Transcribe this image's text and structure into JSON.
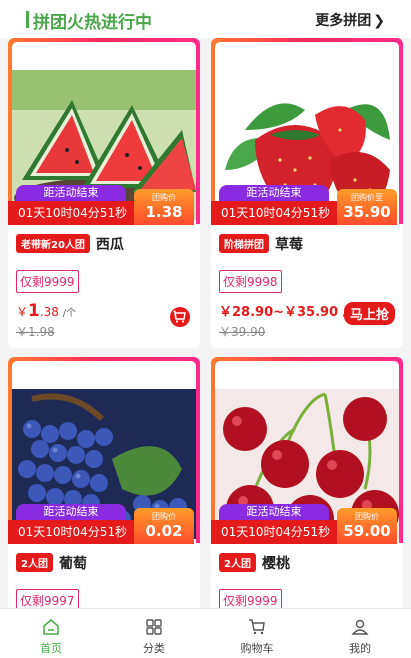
{
  "header": {
    "title": "拼团火热进行中",
    "more": "更多拼团"
  },
  "products": [
    {
      "photo": "watermelon",
      "end_label": "距活动结束",
      "timer": "01天10时04分51秒",
      "price_label": "团购价",
      "price_value": "1.38",
      "badge": "老带新20人团",
      "name": "西瓜",
      "remain": "仅剩9999",
      "price_symbol": "￥",
      "price_int": "1",
      "price_dec": ".38",
      "unit": "/个",
      "orig": "￥1.98",
      "action": "cart-icon"
    },
    {
      "photo": "strawberry",
      "end_label": "距活动结束",
      "timer": "01天10时04分51秒",
      "price_label": "团购价至",
      "price_value": "35.90",
      "badge": "阶梯拼团",
      "name": "草莓",
      "remain": "仅剩9998",
      "price_text": "￥28.90~￥35.90",
      "unit": "/件",
      "orig": "￥39.90",
      "action": "马上抢"
    },
    {
      "photo": "grape",
      "end_label": "距活动结束",
      "timer": "01天10时04分51秒",
      "price_label": "团购价",
      "price_value": "0.02",
      "badge": "2人团",
      "name": "葡萄",
      "remain": "仅剩9997"
    },
    {
      "photo": "cherry",
      "end_label": "距活动结束",
      "timer": "01天10时04分51秒",
      "price_label": "团购价",
      "price_value": "59.00",
      "badge": "2人团",
      "name": "樱桃",
      "remain": "仅剩9999"
    }
  ],
  "tabbar": [
    {
      "label": "首页",
      "icon": "home-icon",
      "active": true
    },
    {
      "label": "分类",
      "icon": "category-icon",
      "active": false
    },
    {
      "label": "购物车",
      "icon": "cart-icon",
      "active": false
    },
    {
      "label": "我的",
      "icon": "user-icon",
      "active": false
    }
  ],
  "colors": {
    "accent_green": "#4aa84a",
    "price_red": "#e51a1a",
    "countdown_purple": "#8a2be2"
  }
}
